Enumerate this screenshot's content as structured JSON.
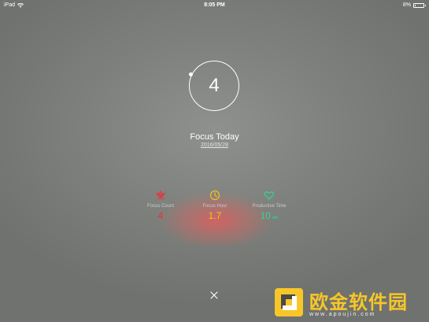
{
  "status_bar": {
    "device": "iPad",
    "time": "8:05 PM",
    "battery_percent": "8%",
    "battery_level": 0.08
  },
  "timer": {
    "count": "4"
  },
  "focus": {
    "title": "Focus Today",
    "date": "2016/05/28"
  },
  "stats": [
    {
      "label": "Focus Count",
      "value": "4",
      "unit": "",
      "color": "#e8323c",
      "icon": "lotus-icon"
    },
    {
      "label": "Focus Hour",
      "value": "1.7",
      "unit": "",
      "color": "#f5c21b",
      "icon": "clock-icon"
    },
    {
      "label": "Productive Time",
      "value": "10",
      "unit": "AM",
      "color": "#33d3a0",
      "icon": "heart-icon"
    }
  ],
  "watermark": {
    "title": "欧金软件园",
    "url": "www.apoujin.com",
    "color": "#f7c628"
  }
}
